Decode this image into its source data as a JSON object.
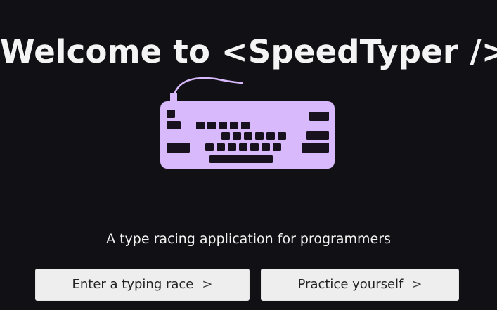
{
  "header": {
    "title": "Welcome to <SpeedTyper />"
  },
  "logo": {
    "icon": "keyboard-icon",
    "color": "#d8b9fb"
  },
  "tagline": "A type racing application for programmers",
  "actions": {
    "race_label": "Enter a typing race",
    "practice_label": "Practice yourself",
    "chevron": ">"
  }
}
